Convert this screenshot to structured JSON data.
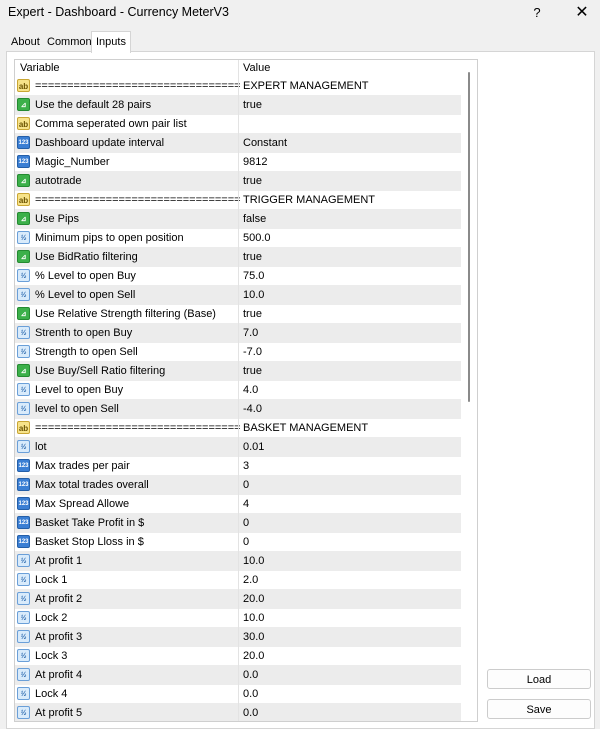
{
  "window": {
    "title": "Expert - Dashboard - Currency MeterV3",
    "help_label": "?",
    "close_label": "✕"
  },
  "tabs": [
    {
      "label": "About"
    },
    {
      "label": "Common"
    },
    {
      "label": "Inputs"
    }
  ],
  "grid": {
    "columns": {
      "variable": "Variable",
      "value": "Value"
    },
    "rows": [
      {
        "icon": "ab",
        "variable": "================================",
        "value": "EXPERT MANAGEMENT"
      },
      {
        "icon": "bool",
        "variable": "Use the default 28 pairs",
        "value": "true"
      },
      {
        "icon": "ab",
        "variable": "Comma seperated own pair list",
        "value": ""
      },
      {
        "icon": "int",
        "variable": "Dashboard update interval",
        "value": "Constant"
      },
      {
        "icon": "int",
        "variable": "Magic_Number",
        "value": "9812"
      },
      {
        "icon": "bool",
        "variable": "autotrade",
        "value": "true"
      },
      {
        "icon": "ab",
        "variable": "================================",
        "value": "TRIGGER MANAGEMENT"
      },
      {
        "icon": "bool",
        "variable": "Use Pips",
        "value": "false"
      },
      {
        "icon": "dbl",
        "variable": "Minimum pips to open position",
        "value": "500.0"
      },
      {
        "icon": "bool",
        "variable": "Use BidRatio filtering",
        "value": "true"
      },
      {
        "icon": "dbl",
        "variable": "% Level to open Buy",
        "value": "75.0"
      },
      {
        "icon": "dbl",
        "variable": "% Level to open Sell",
        "value": "10.0"
      },
      {
        "icon": "bool",
        "variable": "Use Relative Strength filtering (Base)",
        "value": "true"
      },
      {
        "icon": "dbl",
        "variable": "Strenth to open Buy",
        "value": "7.0"
      },
      {
        "icon": "dbl",
        "variable": "Strength to open Sell",
        "value": "-7.0"
      },
      {
        "icon": "bool",
        "variable": "Use Buy/Sell Ratio filtering",
        "value": "true"
      },
      {
        "icon": "dbl",
        "variable": "Level to open Buy",
        "value": "4.0"
      },
      {
        "icon": "dbl",
        "variable": "level to open Sell",
        "value": "-4.0"
      },
      {
        "icon": "ab",
        "variable": "================================",
        "value": "BASKET MANAGEMENT"
      },
      {
        "icon": "dbl",
        "variable": "lot",
        "value": "0.01"
      },
      {
        "icon": "int",
        "variable": "Max trades per pair",
        "value": "3"
      },
      {
        "icon": "int",
        "variable": "Max total trades overall",
        "value": "0"
      },
      {
        "icon": "int",
        "variable": "Max Spread Allowe",
        "value": "4"
      },
      {
        "icon": "int",
        "variable": "Basket Take Profit in $",
        "value": "0"
      },
      {
        "icon": "int",
        "variable": "Basket Stop Lloss in $",
        "value": "0"
      },
      {
        "icon": "dbl",
        "variable": "At profit 1",
        "value": "10.0"
      },
      {
        "icon": "dbl",
        "variable": "Lock 1",
        "value": "2.0"
      },
      {
        "icon": "dbl",
        "variable": "At profit 2",
        "value": "20.0"
      },
      {
        "icon": "dbl",
        "variable": "Lock 2",
        "value": "10.0"
      },
      {
        "icon": "dbl",
        "variable": "At profit 3",
        "value": "30.0"
      },
      {
        "icon": "dbl",
        "variable": "Lock 3",
        "value": "20.0"
      },
      {
        "icon": "dbl",
        "variable": "At profit 4",
        "value": "0.0"
      },
      {
        "icon": "dbl",
        "variable": "Lock 4",
        "value": "0.0"
      },
      {
        "icon": "dbl",
        "variable": "At profit 5",
        "value": "0.0"
      }
    ]
  },
  "icon_glyphs": {
    "ab": "ab",
    "bool": "⊿",
    "int": "123",
    "dbl": "½"
  },
  "icon_names": {
    "ab": "string-type-icon",
    "bool": "bool-type-icon",
    "int": "integer-type-icon",
    "dbl": "double-type-icon"
  },
  "buttons": {
    "load_label": "Load",
    "save_label": "Save"
  }
}
